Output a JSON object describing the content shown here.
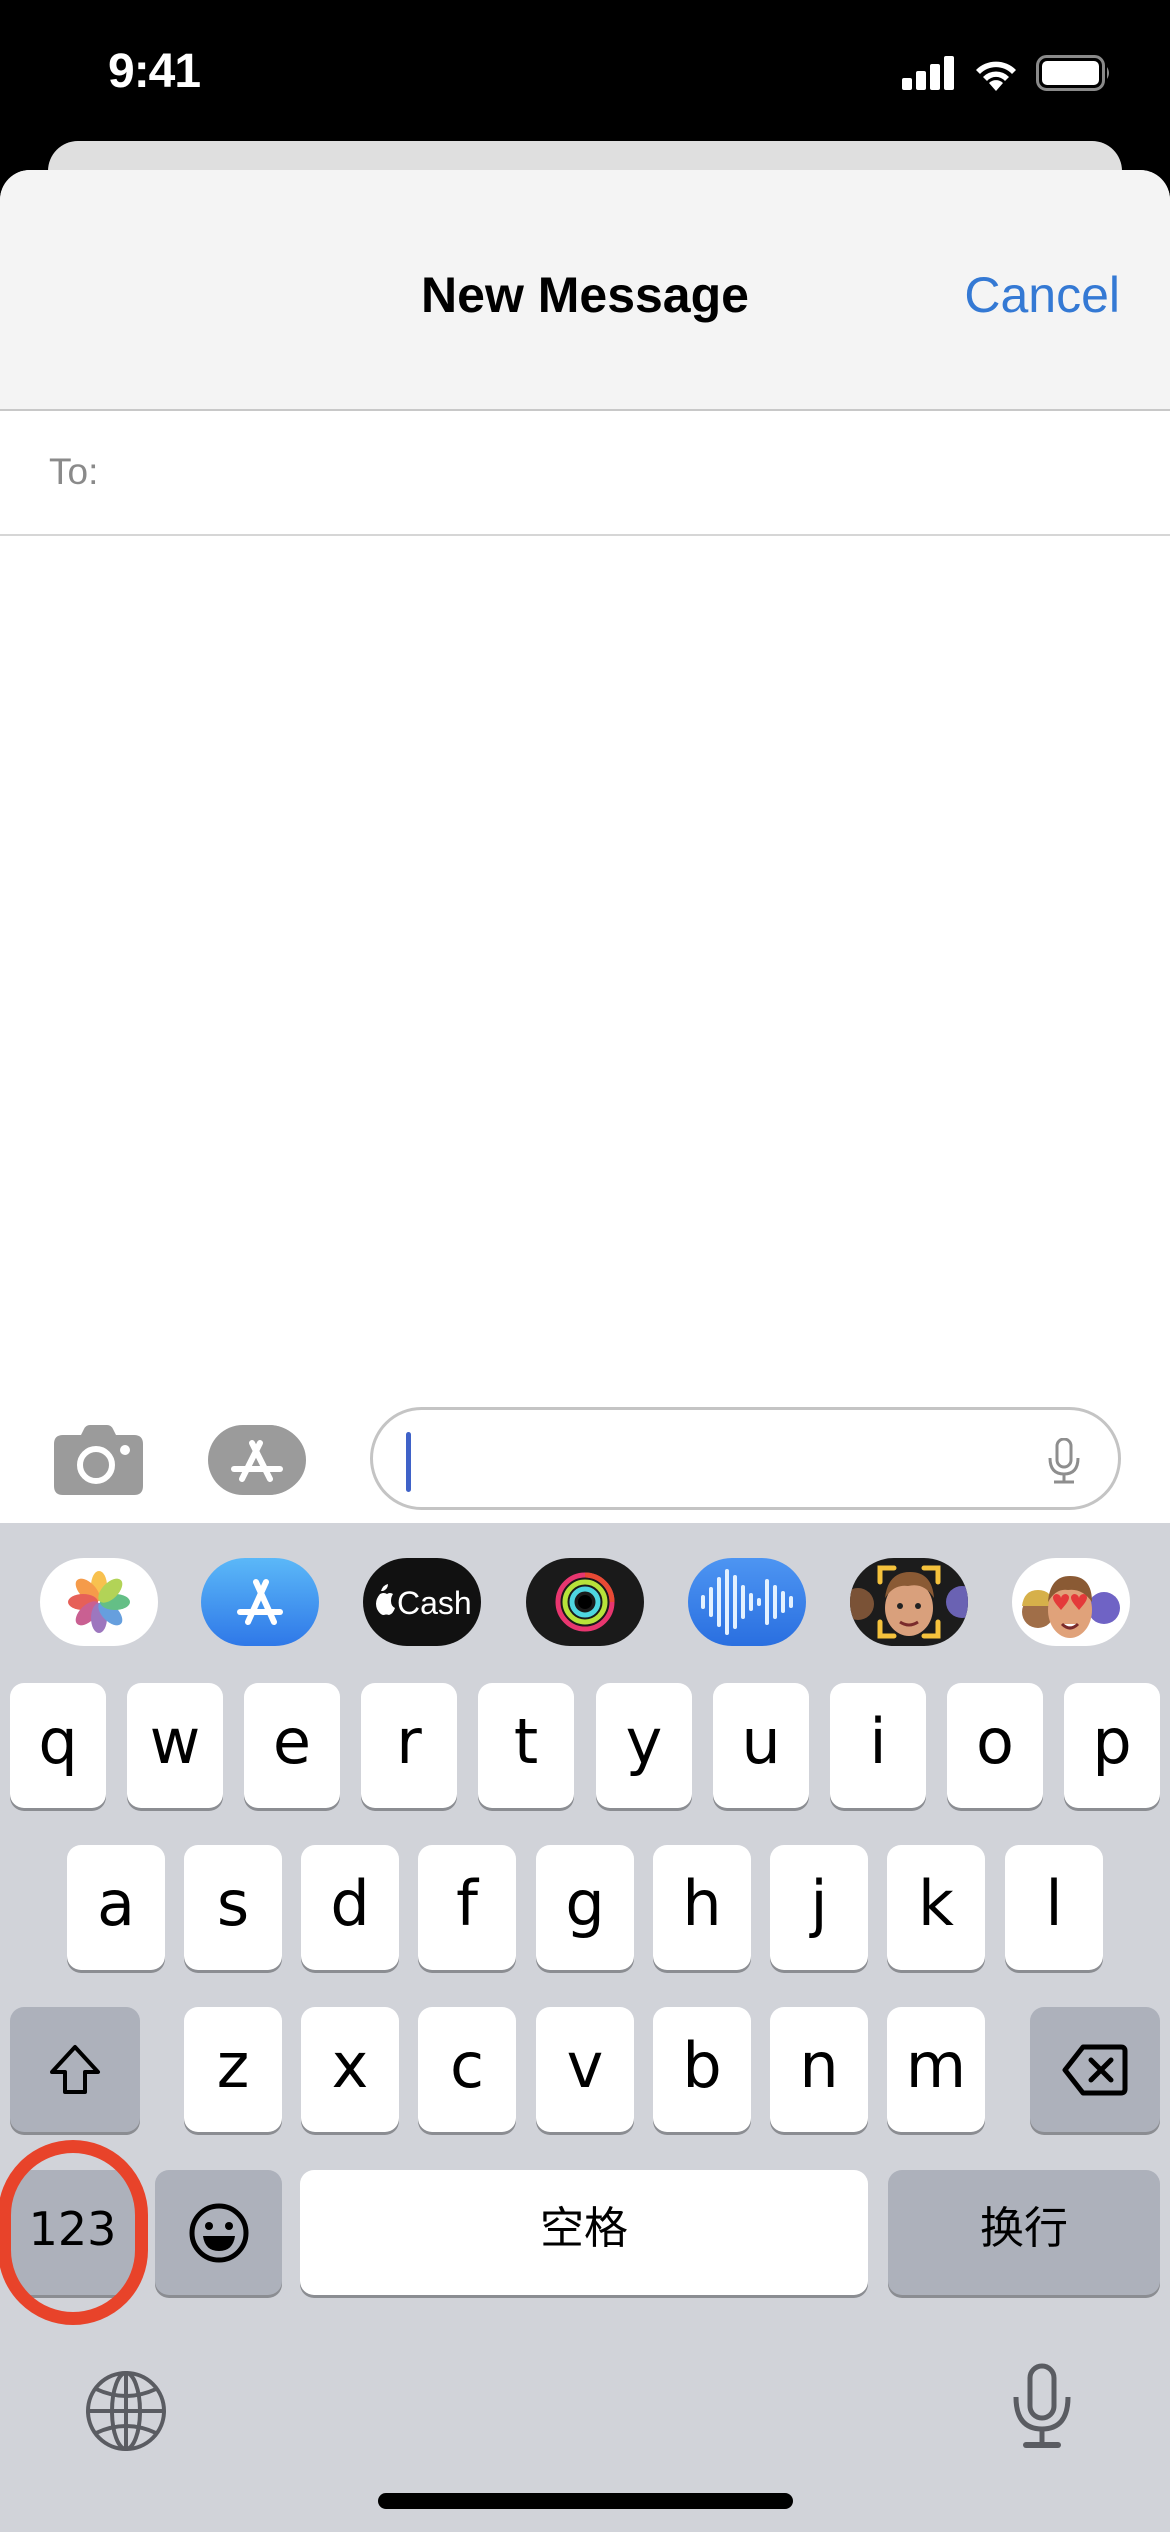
{
  "status_bar": {
    "time": "9:41",
    "icons": [
      "cellular-signal-icon",
      "wifi-icon",
      "battery-icon"
    ]
  },
  "nav": {
    "title": "New Message",
    "cancel_label": "Cancel",
    "accent_color": "#3479d4"
  },
  "recipient": {
    "label": "To:",
    "value": "",
    "placeholder": ""
  },
  "compose": {
    "camera_icon": "camera-icon",
    "apps_icon": "app-store-icon",
    "message_value": "",
    "message_placeholder": "",
    "dictation_icon": "microphone-icon"
  },
  "app_strip": [
    {
      "name": "Photos",
      "icon": "photos-icon"
    },
    {
      "name": "App Store",
      "icon": "app-store-icon"
    },
    {
      "name": "Apple Cash",
      "icon": "apple-cash-icon",
      "label": "Cash"
    },
    {
      "name": "Activity",
      "icon": "activity-rings-icon"
    },
    {
      "name": "Audio Message",
      "icon": "waveform-icon"
    },
    {
      "name": "Memoji",
      "icon": "memoji-camera-icon"
    },
    {
      "name": "Memoji Stickers",
      "icon": "memoji-stickers-icon"
    }
  ],
  "keyboard": {
    "row1": [
      "q",
      "w",
      "e",
      "r",
      "t",
      "y",
      "u",
      "i",
      "o",
      "p"
    ],
    "row2": [
      "a",
      "s",
      "d",
      "f",
      "g",
      "h",
      "j",
      "k",
      "l"
    ],
    "row3": [
      "z",
      "x",
      "c",
      "v",
      "b",
      "n",
      "m"
    ],
    "shift_icon": "shift-icon",
    "delete_icon": "delete-icon",
    "numbers_label": "123",
    "emoji_icon": "emoji-icon",
    "space_label": "空格",
    "return_label": "换行",
    "globe_icon": "globe-icon",
    "dictation_icon": "microphone-icon",
    "highlight_color": "#e8432a"
  }
}
